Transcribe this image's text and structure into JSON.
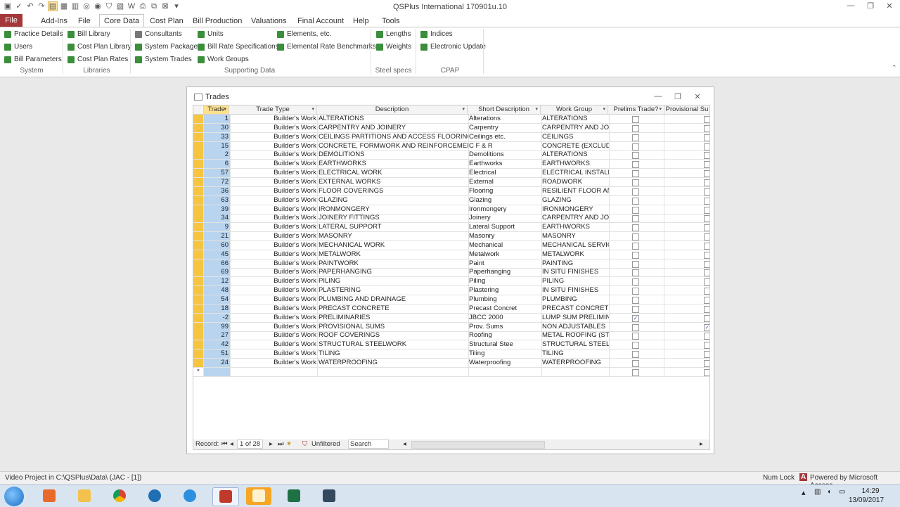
{
  "app": {
    "title": "QSPlus International 170901u.10",
    "window_minimize": "—",
    "window_restore": "❐",
    "window_close": "✕"
  },
  "ribbon": {
    "tabs": [
      "File",
      "Add-Ins",
      "File",
      "Core Data",
      "Cost Plan",
      "Bill Production",
      "Valuations",
      "Final Account",
      "Help",
      "Tools"
    ],
    "active_tab": "Core Data",
    "groups": {
      "system": {
        "label": "System",
        "items": [
          "Practice Details",
          "Users",
          "Bill Parameters"
        ]
      },
      "libraries": {
        "label": "Libraries",
        "items": [
          "Bill Library",
          "Cost Plan Library",
          "Cost Plan Rates"
        ]
      },
      "supporting": {
        "label": "Supporting Data",
        "items": [
          "Consultants",
          "System Packages",
          "System Trades",
          "Units",
          "Bill Rate Specifications",
          "Work Groups",
          "Elements, etc.",
          "Elemental Rate Benchmarks"
        ]
      },
      "steel": {
        "label": "Steel specs",
        "items": [
          "Lengths",
          "Weights"
        ]
      },
      "cpap": {
        "label": "CPAP",
        "items": [
          "Indices",
          "Electronic Update"
        ]
      }
    }
  },
  "trades_window": {
    "title": "Trades",
    "columns": [
      "Trade",
      "Trade Type",
      "Description",
      "Short Description",
      "Work Group",
      "Prelims Trade?",
      "Provisional Su"
    ],
    "rows": [
      {
        "code": "1",
        "type": "Builder's Work",
        "desc": "ALTERATIONS",
        "short": "Alterations",
        "group": "ALTERATIONS",
        "prelims": false,
        "prov": false
      },
      {
        "code": "30",
        "type": "Builder's Work",
        "desc": "CARPENTRY AND JOINERY",
        "short": "Carpentry",
        "group": "CARPENTRY AND JOINE",
        "prelims": false,
        "prov": false
      },
      {
        "code": "33",
        "type": "Builder's Work",
        "desc": "CEILINGS PARTITIONS AND ACCESS FLOORING",
        "short": "Ceilings etc.",
        "group": "CEILINGS",
        "prelims": false,
        "prov": false
      },
      {
        "code": "15",
        "type": "Builder's Work",
        "desc": "CONCRETE, FORMWORK AND REINFORCEMENT",
        "short": "C F & R",
        "group": "CONCRETE (EXCLUDIN",
        "prelims": false,
        "prov": false
      },
      {
        "code": "2",
        "type": "Builder's Work",
        "desc": "DEMOLITIONS",
        "short": "Demolitions",
        "group": "ALTERATIONS",
        "prelims": false,
        "prov": false
      },
      {
        "code": "6",
        "type": "Builder's Work",
        "desc": "EARTHWORKS",
        "short": "Earthworks",
        "group": "EARTHWORKS",
        "prelims": false,
        "prov": false
      },
      {
        "code": "57",
        "type": "Builder's Work",
        "desc": "ELECTRICAL WORK",
        "short": "Electrical",
        "group": "ELECTRICAL INSTALLAT",
        "prelims": false,
        "prov": false
      },
      {
        "code": "72",
        "type": "Builder's Work",
        "desc": "EXTERNAL WORKS",
        "short": "External",
        "group": "ROADWORK",
        "prelims": false,
        "prov": false
      },
      {
        "code": "36",
        "type": "Builder's Work",
        "desc": "FLOOR COVERINGS",
        "short": "Flooring",
        "group": "RESILIENT FLOOR AND",
        "prelims": false,
        "prov": false
      },
      {
        "code": "63",
        "type": "Builder's Work",
        "desc": "GLAZING",
        "short": "Glazing",
        "group": "GLAZING",
        "prelims": false,
        "prov": false
      },
      {
        "code": "39",
        "type": "Builder's Work",
        "desc": "IRONMONGERY",
        "short": "Ironmongery",
        "group": "IRONMONGERY",
        "prelims": false,
        "prov": false
      },
      {
        "code": "34",
        "type": "Builder's Work",
        "desc": "JOINERY FITTINGS",
        "short": "Joinery",
        "group": "CARPENTRY AND JOINE",
        "prelims": false,
        "prov": false
      },
      {
        "code": "9",
        "type": "Builder's Work",
        "desc": "LATERAL SUPPORT",
        "short": "Lateral Support",
        "group": "EARTHWORKS",
        "prelims": false,
        "prov": false
      },
      {
        "code": "21",
        "type": "Builder's Work",
        "desc": "MASONRY",
        "short": "Masonry",
        "group": "MASONRY",
        "prelims": false,
        "prov": false
      },
      {
        "code": "60",
        "type": "Builder's Work",
        "desc": "MECHANICAL WORK",
        "short": "Mechanical",
        "group": "MECHANICAL SERVICE",
        "prelims": false,
        "prov": false
      },
      {
        "code": "45",
        "type": "Builder's Work",
        "desc": "METALWORK",
        "short": "Metalwork",
        "group": "METALWORK",
        "prelims": false,
        "prov": false
      },
      {
        "code": "66",
        "type": "Builder's Work",
        "desc": "PAINTWORK",
        "short": "Paint",
        "group": "PAINTING",
        "prelims": false,
        "prov": false
      },
      {
        "code": "69",
        "type": "Builder's Work",
        "desc": "PAPERHANGING",
        "short": "Paperhanging",
        "group": "IN SITU FINISHES",
        "prelims": false,
        "prov": false
      },
      {
        "code": "12",
        "type": "Builder's Work",
        "desc": "PILING",
        "short": "Piling",
        "group": "PILING",
        "prelims": false,
        "prov": false
      },
      {
        "code": "48",
        "type": "Builder's Work",
        "desc": "PLASTERING",
        "short": "Plastering",
        "group": "IN SITU FINISHES",
        "prelims": false,
        "prov": false
      },
      {
        "code": "54",
        "type": "Builder's Work",
        "desc": "PLUMBING AND DRAINAGE",
        "short": "Plumbing",
        "group": "PLUMBING",
        "prelims": false,
        "prov": false
      },
      {
        "code": "18",
        "type": "Builder's Work",
        "desc": "PRECAST CONCRETE",
        "short": "Precast Concret",
        "group": "PRECAST CONCRETE",
        "prelims": false,
        "prov": false
      },
      {
        "code": "-2",
        "type": "Builder's Work",
        "desc": "PRELIMINARIES",
        "short": "JBCC 2000",
        "group": "LUMP SUM PRELIMINA",
        "prelims": true,
        "prov": false
      },
      {
        "code": "99",
        "type": "Builder's Work",
        "desc": "PROVISIONAL SUMS",
        "short": "Prov. Sums",
        "group": "NON ADJUSTABLES",
        "prelims": false,
        "prov": true
      },
      {
        "code": "27",
        "type": "Builder's Work",
        "desc": "ROOF COVERINGS",
        "short": "Roofing",
        "group": "METAL ROOFING (STEE",
        "prelims": false,
        "prov": false
      },
      {
        "code": "42",
        "type": "Builder's Work",
        "desc": "STRUCTURAL STEELWORK",
        "short": "Structural Stee",
        "group": "STRUCTURAL STEELWC",
        "prelims": false,
        "prov": false
      },
      {
        "code": "51",
        "type": "Builder's Work",
        "desc": "TILING",
        "short": "Tiling",
        "group": "TILING",
        "prelims": false,
        "prov": false
      },
      {
        "code": "24",
        "type": "Builder's Work",
        "desc": "WATERPROOFING",
        "short": "Waterproofing",
        "group": "WATERPROOFING",
        "prelims": false,
        "prov": false
      }
    ],
    "new_row_marker": "*",
    "nav": {
      "record_label": "Record:",
      "position": "1 of 28",
      "filter": "Unfiltered",
      "search_placeholder": "Search"
    }
  },
  "statusbar": {
    "left": "Video Project in C:\\QSPlus\\Data\\ (JAC - [1])",
    "numlock": "Num Lock",
    "powered": "Powered by Microsoft Access"
  },
  "taskbar": {
    "time": "14:29",
    "date": "13/09/2017"
  }
}
